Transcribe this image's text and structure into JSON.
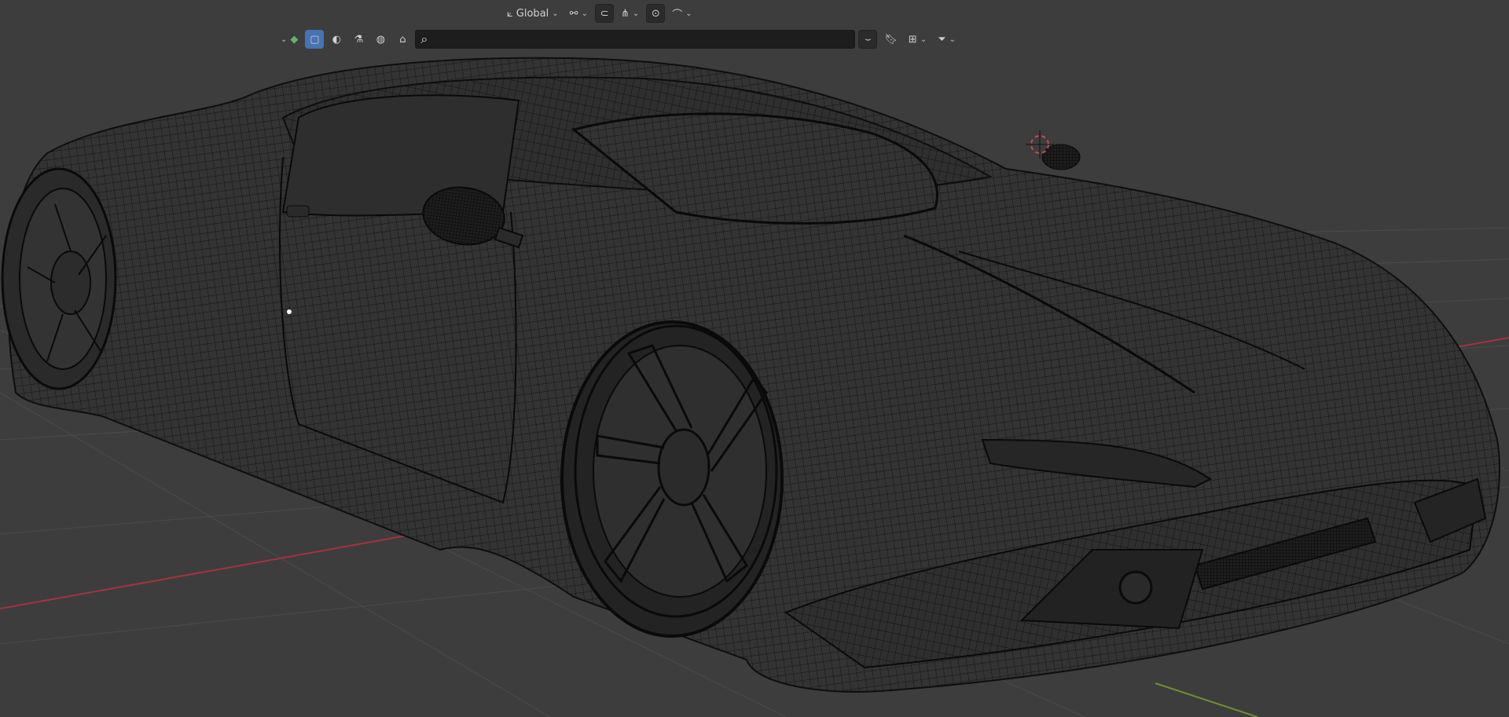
{
  "app": "Blender",
  "header": {
    "transform_orientation": {
      "icon": "transform-orientation-icon",
      "value": "Global"
    },
    "pivot": {
      "icon": "pivot-link-icon"
    },
    "snap": {
      "icon": "snap-magnet-icon",
      "target_icon": "snap-target-icon"
    },
    "proportional": {
      "icon": "proportional-edit-icon",
      "falloff_icon": "falloff-curve-icon"
    }
  },
  "outliner_bar": {
    "display_mode_icon": "display-mode-icon",
    "filter_icons": [
      "select-mode-icon",
      "shading-icon",
      "render-icon",
      "world-icon",
      "brush-icon"
    ],
    "search": {
      "value": "",
      "placeholder": ""
    },
    "right_icons": [
      "collapse-icon",
      "bookmark-icon",
      "hierarchy-icon",
      "filter-icon"
    ]
  },
  "viewport": {
    "colors": {
      "background": "#3d3d3d",
      "grid": "#4a4a4a",
      "x_axis": "#a5333c",
      "y_axis": "#6f8f2e",
      "wire": "#0e0e0e",
      "cursor": "#c84a4a"
    }
  }
}
